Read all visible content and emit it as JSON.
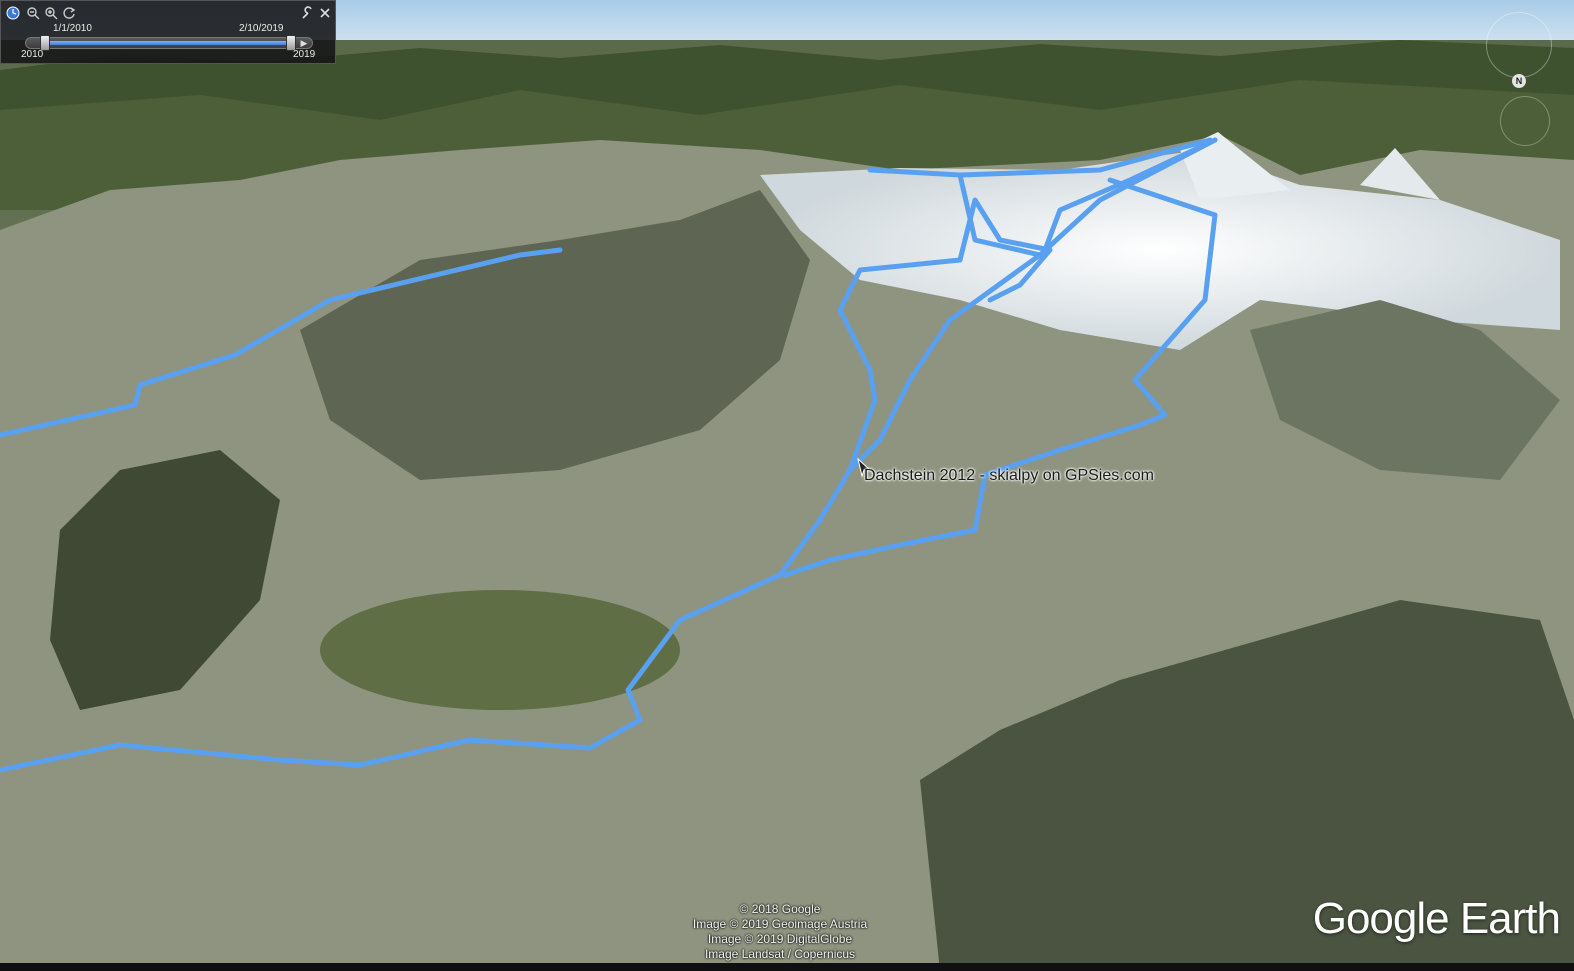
{
  "time_slider": {
    "start_date": "1/1/2010",
    "end_date": "2/10/2019",
    "start_year": "2010",
    "end_year": "2019"
  },
  "placemark": {
    "label": "Dachstein 2012 - skialpy on GPSies.com"
  },
  "attribution": {
    "lines": [
      "© 2018 Google",
      "Image © 2019 Geoimage Austria",
      "Image © 2019 DigitalGlobe",
      "Image Landsat / Copernicus"
    ]
  },
  "logo": "Google Earth",
  "navigation": {
    "north_label": "N"
  },
  "icons": [
    "clock-icon",
    "zoom-out-icon",
    "zoom-in-icon",
    "refresh-icon",
    "wrench-icon",
    "close-icon",
    "compass-icon",
    "placemark-icon"
  ],
  "colors": {
    "track": "#5aa0f0",
    "sky": "#cfe4f3",
    "snow": "#eef2f4",
    "vegetation": "#4a5e35"
  }
}
